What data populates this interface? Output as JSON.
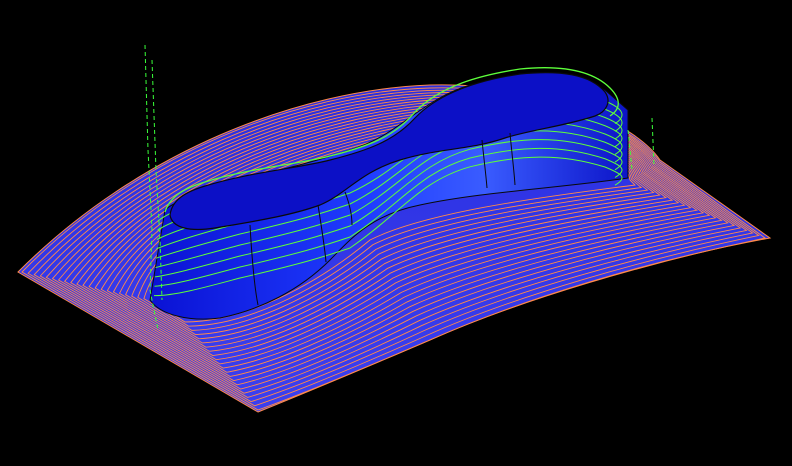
{
  "viewport": {
    "background": "#000000"
  },
  "model": {
    "surface_fill": "#2f33e6",
    "boss_fill": "#0a12d4",
    "boss_top_fill": "#0c10c6",
    "boss_highlight": "#4a66ff"
  },
  "toolpaths": {
    "surface_path_color": "#ff8a4a",
    "surface_path_count": 22,
    "wall_path_color": "#5dff3a",
    "wall_path_count": 9,
    "plunge_color": "#39ff39",
    "edge_color": "#0a0a0a"
  }
}
